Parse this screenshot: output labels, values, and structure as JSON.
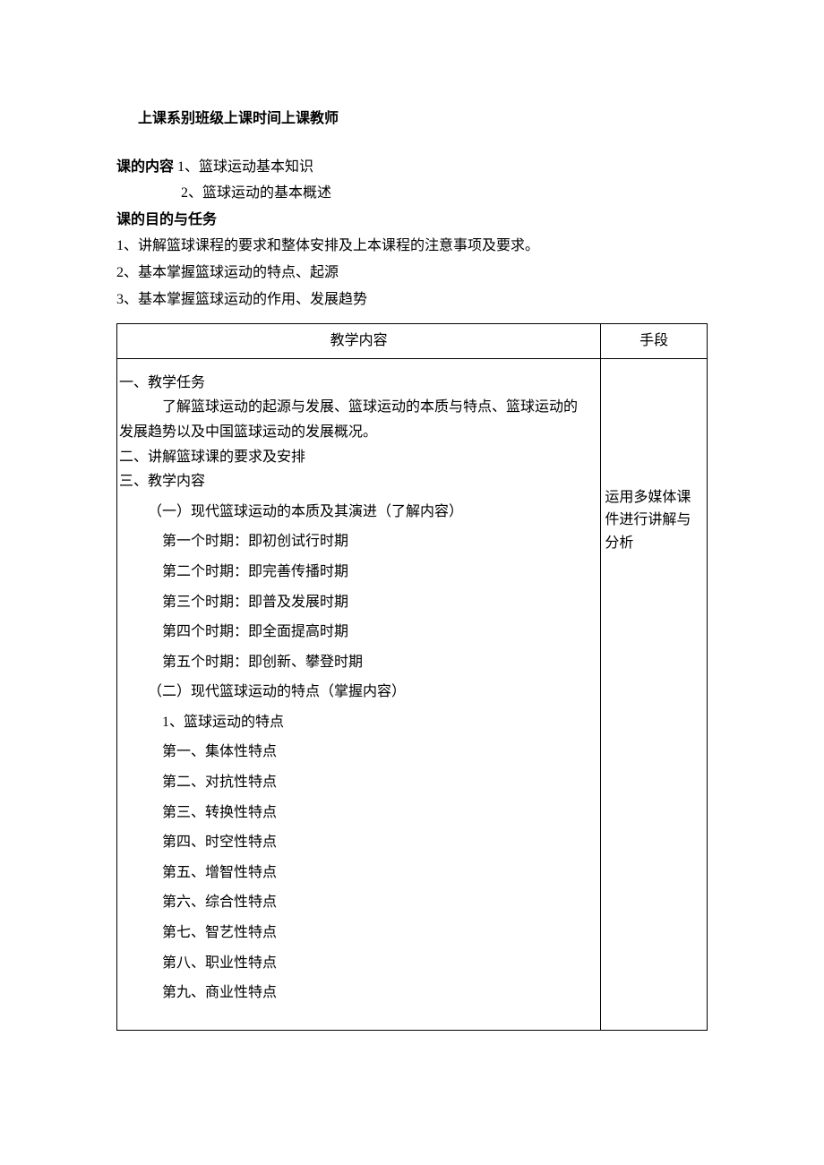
{
  "header": "上课系别班级上课时间上课教师",
  "content_label": "课的内容",
  "content_items": [
    "1、篮球运动基本知识",
    "2、篮球运动的基本概述"
  ],
  "objective_label": "课的目的与任务",
  "objectives": [
    "1、讲解篮球课程的要求和整体安排及上本课程的注意事项及要求。",
    "2、基本掌握篮球运动的特点、起源",
    "3、基本掌握篮球运动的作用、发展趋势"
  ],
  "table": {
    "header_left": "教学内容",
    "header_right": "手段",
    "section1_title": "一、教学任务",
    "section1_body_line1": "了解篮球运动的起源与发展、篮球运动的本质与特点、篮球运动的",
    "section1_body_line2": "发展趋势以及中国篮球运动的发展概况。",
    "section2": "二、讲解篮球课的要求及安排",
    "section3": "三、教学内容",
    "sub1_title": "（一）现代篮球运动的本质及其演进（了解内容）",
    "periods": [
      "第一个时期：即初创试行时期",
      "第二个时期：即完善传播时期",
      "第三个时期：即普及发展时期",
      "第四个时期：即全面提高时期",
      "第五个时期：即创新、攀登时期"
    ],
    "sub2_title": "（二）现代篮球运动的特点（掌握内容）",
    "features_title": "1、篮球运动的特点",
    "features": [
      "第一、集体性特点",
      "第二、对抗性特点",
      "第三、转换性特点",
      "第四、时空性特点",
      "第五、增智性特点",
      "第六、综合性特点",
      "第七、智艺性特点",
      "第八、职业性特点",
      "第九、商业性特点"
    ],
    "method": "运用多媒体课件进行讲解与分析"
  }
}
